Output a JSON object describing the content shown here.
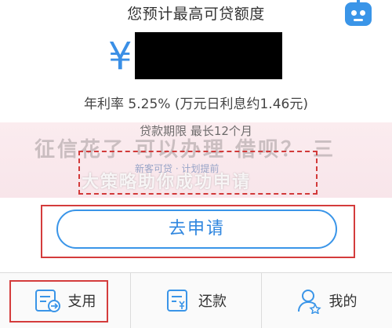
{
  "header": {
    "title": "您预计最高可贷额度"
  },
  "icons": {
    "assistant": "robot-icon"
  },
  "amount": {
    "currency_symbol": "¥"
  },
  "rate_line": "年利率 5.25% (万元日利息约1.46元)",
  "term_line": "贷款期限 最长12个月",
  "overlay": {
    "watermark_line1": "征信花了 可以办理 借呗？ 三",
    "sub_hint": "新客可贷 · 计划提前",
    "watermark_line2": "大策略助你成功申请"
  },
  "apply_button": {
    "label": "去申请"
  },
  "bottom_nav": {
    "items": [
      {
        "label": "支用",
        "icon": "withdraw-icon"
      },
      {
        "label": "还款",
        "icon": "repay-icon"
      },
      {
        "label": "我的",
        "icon": "profile-icon"
      }
    ]
  },
  "colors": {
    "accent": "#3a95e8",
    "highlight_border": "#d43c3c",
    "band": "#f9e8ec"
  }
}
